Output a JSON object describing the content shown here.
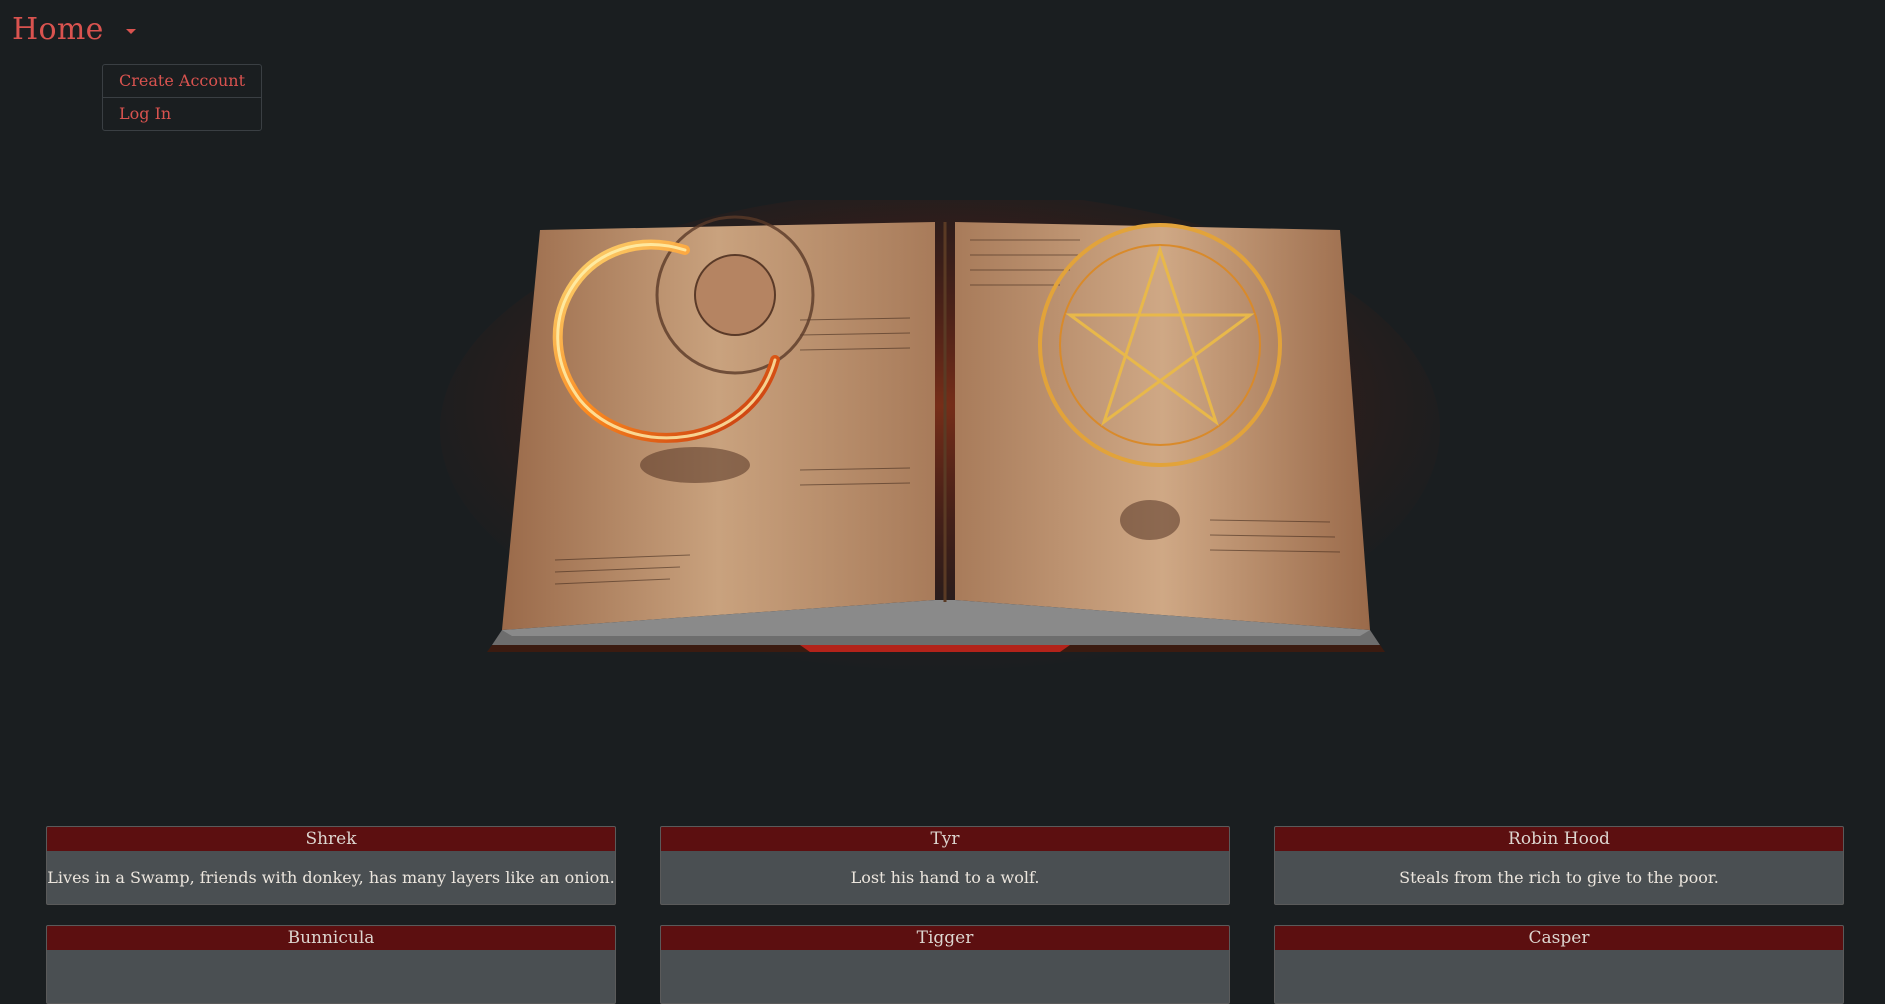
{
  "nav": {
    "title": "Home",
    "menu": [
      {
        "label": "Create Account"
      },
      {
        "label": "Log In"
      }
    ]
  },
  "colors": {
    "background": "#1a1e20",
    "accent": "#d9534f",
    "card_header": "#5c0f10",
    "card_body": "#4a4f52"
  },
  "hero": {
    "icon": "open-spellbook-image"
  },
  "cards": [
    {
      "name": "Shrek",
      "description": "Lives in a Swamp, friends with donkey, has many layers like an onion."
    },
    {
      "name": "Tyr",
      "description": "Lost his hand to a wolf."
    },
    {
      "name": "Robin Hood",
      "description": "Steals from the rich to give to the poor."
    },
    {
      "name": "Bunnicula",
      "description": ""
    },
    {
      "name": "Tigger",
      "description": ""
    },
    {
      "name": "Casper",
      "description": ""
    }
  ]
}
